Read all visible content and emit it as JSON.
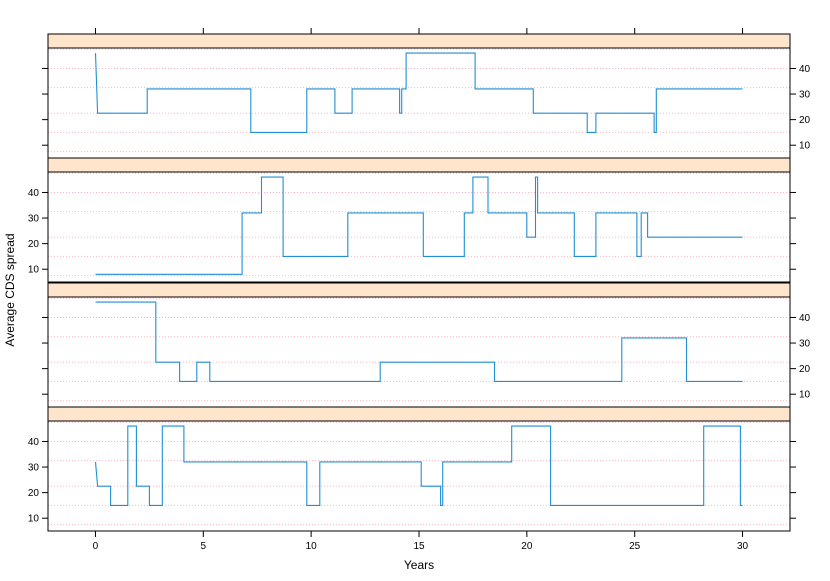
{
  "chart_data": {
    "type": "line",
    "step": true,
    "xlabel": "Years",
    "ylabel": "Average CDS spread",
    "xlim": [
      -2.2,
      32.2
    ],
    "ylim": [
      5,
      48
    ],
    "x_ticks": [
      0,
      5,
      10,
      15,
      20,
      25,
      30
    ],
    "y_ticks": [
      10,
      20,
      30,
      40
    ],
    "grid_lines": [
      7.5,
      15,
      22.5,
      32.5,
      40,
      47.5
    ],
    "grid": true,
    "color": "#1f8fd6",
    "grid_color": "#ffb6c1",
    "strip_color": "#ffe5cc",
    "panels": [
      {
        "y_axis_side": "right",
        "points": [
          [
            0,
            46
          ],
          [
            0.1,
            22.5
          ],
          [
            2.4,
            22.5
          ],
          [
            2.4,
            32
          ],
          [
            7.2,
            32
          ],
          [
            7.2,
            15
          ],
          [
            9.8,
            15
          ],
          [
            9.8,
            32
          ],
          [
            11.1,
            32
          ],
          [
            11.1,
            22.5
          ],
          [
            11.9,
            22.5
          ],
          [
            11.9,
            32
          ],
          [
            14.1,
            32
          ],
          [
            14.1,
            22.5
          ],
          [
            14.2,
            22.5
          ],
          [
            14.2,
            32
          ],
          [
            14.4,
            32
          ],
          [
            14.4,
            46
          ],
          [
            17.6,
            46
          ],
          [
            17.6,
            32
          ],
          [
            20.3,
            32
          ],
          [
            20.3,
            22.5
          ],
          [
            22.8,
            22.5
          ],
          [
            22.8,
            15
          ],
          [
            23.2,
            15
          ],
          [
            23.2,
            22.5
          ],
          [
            25.9,
            22.5
          ],
          [
            25.9,
            15
          ],
          [
            26.0,
            15
          ],
          [
            26.0,
            32
          ],
          [
            30,
            32
          ]
        ]
      },
      {
        "y_axis_side": "left",
        "points": [
          [
            0,
            8
          ],
          [
            6.8,
            8
          ],
          [
            6.8,
            32
          ],
          [
            7.7,
            32
          ],
          [
            7.7,
            46
          ],
          [
            8.7,
            46
          ],
          [
            8.7,
            15
          ],
          [
            11.7,
            15
          ],
          [
            11.7,
            32
          ],
          [
            15.2,
            32
          ],
          [
            15.2,
            15
          ],
          [
            17.1,
            15
          ],
          [
            17.1,
            32
          ],
          [
            17.5,
            32
          ],
          [
            17.5,
            46
          ],
          [
            18.2,
            46
          ],
          [
            18.2,
            32
          ],
          [
            20.0,
            32
          ],
          [
            20.0,
            22.5
          ],
          [
            20.4,
            22.5
          ],
          [
            20.4,
            46
          ],
          [
            20.5,
            46
          ],
          [
            20.5,
            32
          ],
          [
            22.2,
            32
          ],
          [
            22.2,
            15
          ],
          [
            23.2,
            15
          ],
          [
            23.2,
            32
          ],
          [
            25.1,
            32
          ],
          [
            25.1,
            15
          ],
          [
            25.3,
            15
          ],
          [
            25.3,
            32
          ],
          [
            25.6,
            32
          ],
          [
            25.6,
            22.5
          ],
          [
            30,
            22.5
          ]
        ]
      },
      {
        "y_axis_side": "right",
        "points": [
          [
            0,
            46
          ],
          [
            2.8,
            46
          ],
          [
            2.8,
            22.5
          ],
          [
            3.9,
            22.5
          ],
          [
            3.9,
            15
          ],
          [
            4.7,
            15
          ],
          [
            4.7,
            22.5
          ],
          [
            5.3,
            22.5
          ],
          [
            5.3,
            15
          ],
          [
            13.2,
            15
          ],
          [
            13.2,
            22.5
          ],
          [
            18.5,
            22.5
          ],
          [
            18.5,
            15
          ],
          [
            24.4,
            15
          ],
          [
            24.4,
            32
          ],
          [
            27.4,
            32
          ],
          [
            27.4,
            15
          ],
          [
            30,
            15
          ]
        ]
      },
      {
        "y_axis_side": "left",
        "points": [
          [
            0,
            32
          ],
          [
            0.1,
            22.5
          ],
          [
            0.7,
            22.5
          ],
          [
            0.7,
            15
          ],
          [
            1.5,
            15
          ],
          [
            1.5,
            46
          ],
          [
            1.9,
            46
          ],
          [
            1.9,
            22.5
          ],
          [
            2.5,
            22.5
          ],
          [
            2.5,
            15
          ],
          [
            3.1,
            15
          ],
          [
            3.1,
            46
          ],
          [
            4.1,
            46
          ],
          [
            4.1,
            32
          ],
          [
            9.8,
            32
          ],
          [
            9.8,
            15
          ],
          [
            10.4,
            15
          ],
          [
            10.4,
            32
          ],
          [
            15.1,
            32
          ],
          [
            15.1,
            22.5
          ],
          [
            16.0,
            22.5
          ],
          [
            16.0,
            15
          ],
          [
            16.1,
            15
          ],
          [
            16.1,
            32
          ],
          [
            19.3,
            32
          ],
          [
            19.3,
            46
          ],
          [
            21.1,
            46
          ],
          [
            21.1,
            15
          ],
          [
            28.2,
            15
          ],
          [
            28.2,
            46
          ],
          [
            29.9,
            46
          ],
          [
            29.9,
            15
          ],
          [
            30,
            15
          ]
        ]
      }
    ]
  }
}
